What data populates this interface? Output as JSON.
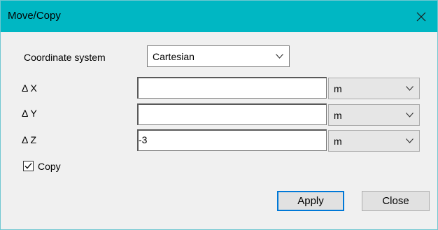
{
  "window": {
    "title": "Move/Copy"
  },
  "coordinate_system": {
    "label": "Coordinate system",
    "value": "Cartesian"
  },
  "fields": [
    {
      "label": "Δ X",
      "value": "",
      "unit": "m"
    },
    {
      "label": "Δ Y",
      "value": "",
      "unit": "m"
    },
    {
      "label": "Δ Z",
      "value": "-3",
      "unit": "m"
    }
  ],
  "copy": {
    "label": "Copy",
    "checked": true
  },
  "buttons": {
    "apply": "Apply",
    "close": "Close"
  }
}
